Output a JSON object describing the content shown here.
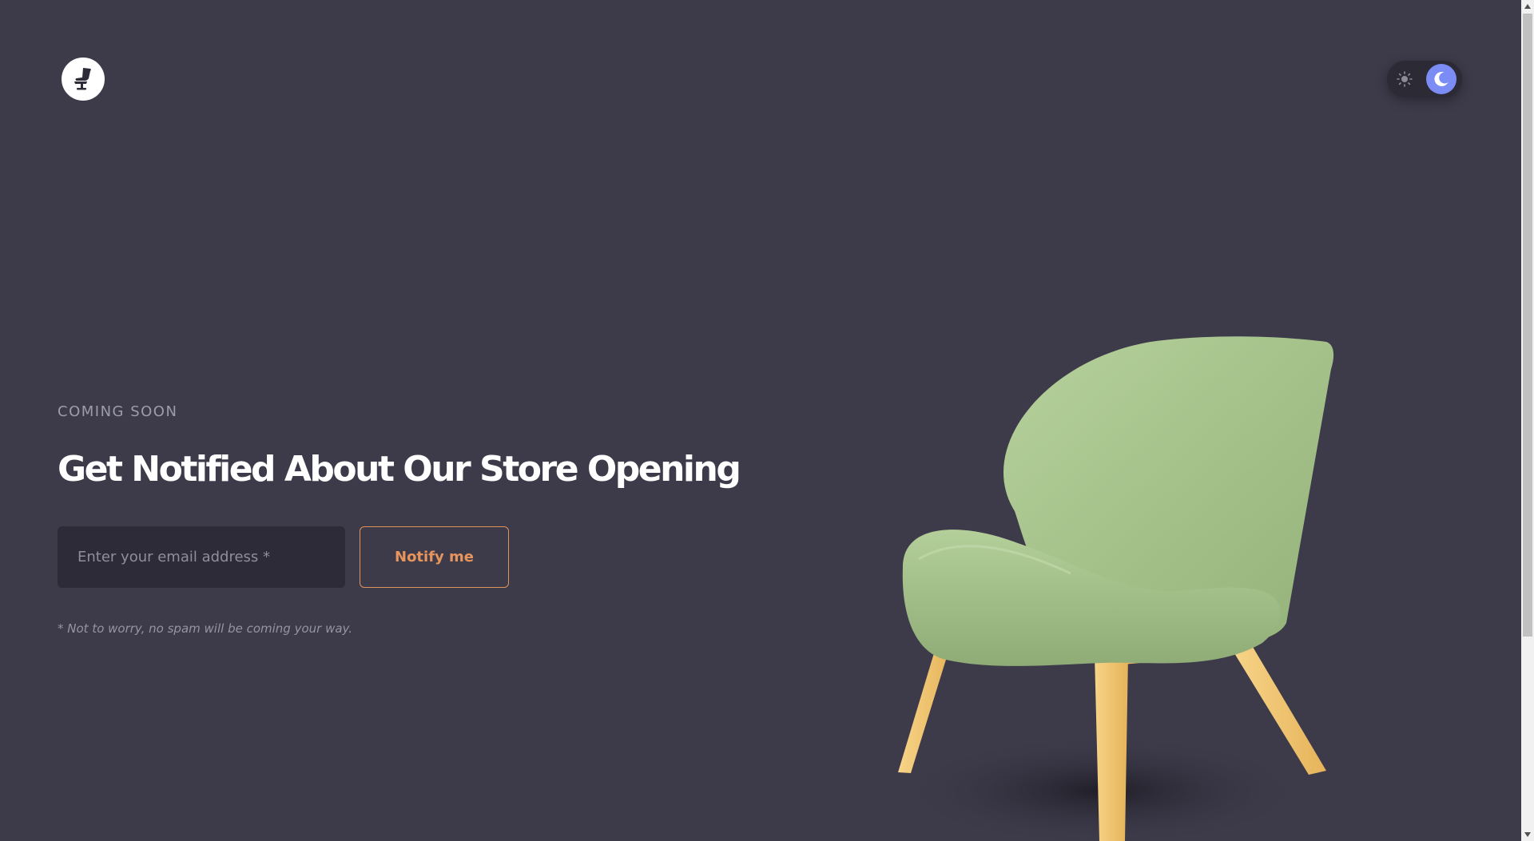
{
  "header": {
    "logo_icon": "chair-logo-icon",
    "theme_toggle": {
      "light_icon": "sun-icon",
      "dark_icon": "moon-icon",
      "active_mode": "dark"
    }
  },
  "hero": {
    "eyebrow": "COMING SOON",
    "title": "Get Notified About Our Store Opening",
    "email": {
      "value": "",
      "placeholder": "Enter your email address *"
    },
    "notify_label": "Notify me",
    "disclaimer": "* Not to worry, no spam will be coming your way."
  },
  "illustration": {
    "subject": "green-lounge-chair"
  },
  "colors": {
    "background": "#3d3b4a",
    "accent": "#e7955c",
    "toggle_active": "#7b8cf5",
    "chair_seat": "#a9c48e",
    "chair_legs": "#f2c36b"
  },
  "scrollbar": {
    "scroll_position": 0
  }
}
